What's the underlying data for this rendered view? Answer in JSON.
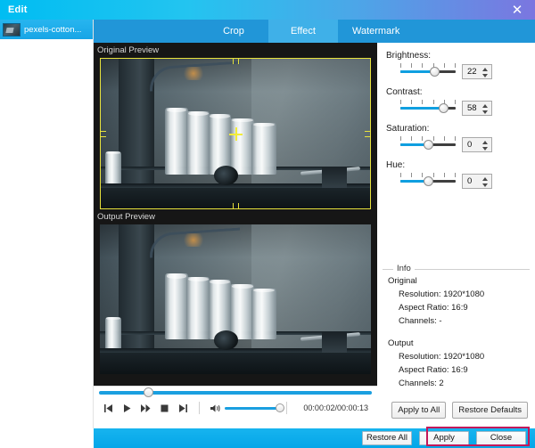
{
  "window": {
    "title": "Edit",
    "close_label": "✕"
  },
  "sidebar": {
    "files": [
      {
        "name": "pexels-cotton...",
        "thumb_icon": "video-thumbnail-icon"
      }
    ]
  },
  "tabs": [
    {
      "id": "crop",
      "label": "Crop",
      "active": false
    },
    {
      "id": "effect",
      "label": "Effect",
      "active": true
    },
    {
      "id": "watermark",
      "label": "Watermark",
      "active": false
    }
  ],
  "preview": {
    "original_label": "Original Preview",
    "output_label": "Output Preview"
  },
  "player": {
    "buttons": [
      {
        "name": "previous-button",
        "icon": "skip-previous-icon"
      },
      {
        "name": "play-button",
        "icon": "play-icon"
      },
      {
        "name": "forward-button",
        "icon": "fast-forward-icon"
      },
      {
        "name": "stop-button",
        "icon": "stop-icon"
      },
      {
        "name": "next-button",
        "icon": "skip-next-icon"
      }
    ],
    "volume_icon": "speaker-icon",
    "time": "00:00:02/00:00:13",
    "seek_position_pct": 18,
    "volume_pct": 100
  },
  "adjustments": [
    {
      "id": "brightness",
      "label": "Brightness:",
      "value": "22",
      "fill_pct": 61
    },
    {
      "id": "contrast",
      "label": "Contrast:",
      "value": "58",
      "fill_pct": 78
    },
    {
      "id": "saturation",
      "label": "Saturation:",
      "value": "0",
      "fill_pct": 50
    },
    {
      "id": "hue",
      "label": "Hue:",
      "value": "0",
      "fill_pct": 50
    }
  ],
  "info": {
    "legend": "Info",
    "original": {
      "heading": "Original",
      "resolution": "Resolution: 1920*1080",
      "aspect_ratio": "Aspect Ratio: 16:9",
      "channels": "Channels: -"
    },
    "output": {
      "heading": "Output",
      "resolution": "Resolution: 1920*1080",
      "aspect_ratio": "Aspect Ratio: 16:9",
      "channels": "Channels: 2"
    }
  },
  "panel_buttons": {
    "apply_to_all": "Apply to All",
    "restore_defaults": "Restore Defaults"
  },
  "action_bar": {
    "restore_all": "Restore All",
    "apply": "Apply",
    "close": "Close"
  },
  "colors": {
    "title_gradient_start": "#00bdf2",
    "title_gradient_end": "#7b76e0",
    "tab_bar": "#2196d8",
    "tab_active": "#3fb0e8",
    "slider_fill": "#0f9fe0",
    "crop_overlay": "#e8e23c",
    "highlight_box": "#c2185b",
    "bottom_bar": "#04a6e8"
  }
}
